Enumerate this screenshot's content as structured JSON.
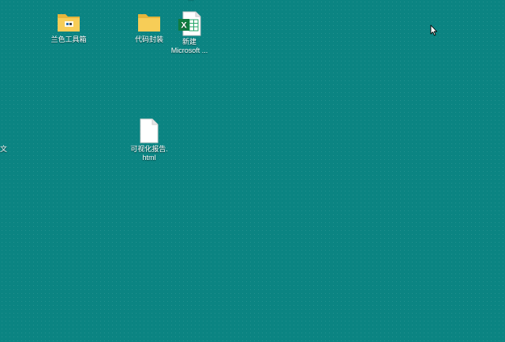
{
  "desktop": {
    "background_color": "#0b8482",
    "icons": [
      {
        "label": "兰色工具箱",
        "icon": "folder-with-shortcut-icon"
      },
      {
        "label": "代码封装",
        "icon": "folder-icon"
      },
      {
        "label_line1": "新建",
        "label_line2": "Microsoft ...",
        "icon": "excel-file-icon"
      },
      {
        "label_line1": "可视化报告.",
        "label_line2": "html",
        "icon": "blank-file-icon"
      }
    ],
    "partial_left_label": "文",
    "partial_top_label": "...",
    "cursor": "mouse-pointer-icon"
  }
}
